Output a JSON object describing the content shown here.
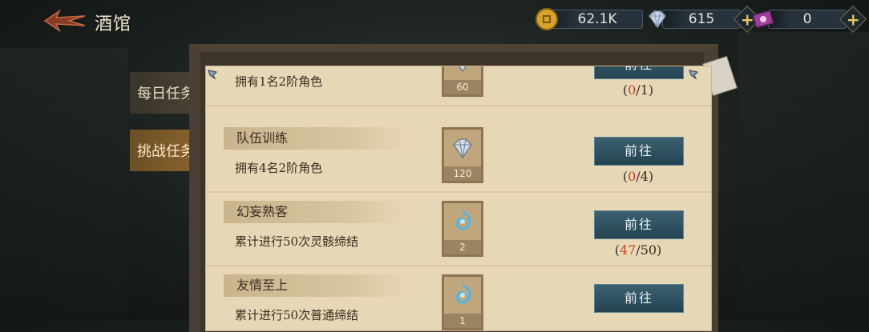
{
  "header": {
    "title": "酒馆"
  },
  "resources": [
    {
      "icon": "coin-icon",
      "value": "62.1K"
    },
    {
      "icon": "diamond-icon",
      "value": "615"
    },
    {
      "icon": "ticket-icon",
      "value": "0"
    }
  ],
  "tabs": {
    "daily": "每日任务",
    "challenge": "挑战任务"
  },
  "tasks": [
    {
      "name": "",
      "desc": "拥有1名2阶角色",
      "reward_icon": "diamond-icon",
      "reward_qty": "60",
      "button": "前往",
      "progress_cur": "0",
      "progress_total": "1"
    },
    {
      "name": "队伍训练",
      "desc": "拥有4名2阶角色",
      "reward_icon": "diamond-icon",
      "reward_qty": "120",
      "button": "前往",
      "progress_cur": "0",
      "progress_total": "4"
    },
    {
      "name": "幻妄熟客",
      "desc": "累计进行50次灵骸缔结",
      "reward_icon": "blue-swirl-icon",
      "reward_qty": "2",
      "button": "前往",
      "progress_cur": "47",
      "progress_total": "50"
    },
    {
      "name": "友情至上",
      "desc": "累计进行50次普通缔结",
      "reward_icon": "blue-swirl-icon",
      "reward_qty": "1",
      "button": "前往",
      "progress_cur": "",
      "progress_total": ""
    }
  ],
  "colors": {
    "accent": "#c8471f",
    "button": "#2f5363",
    "paper": "#e6d7b6"
  }
}
